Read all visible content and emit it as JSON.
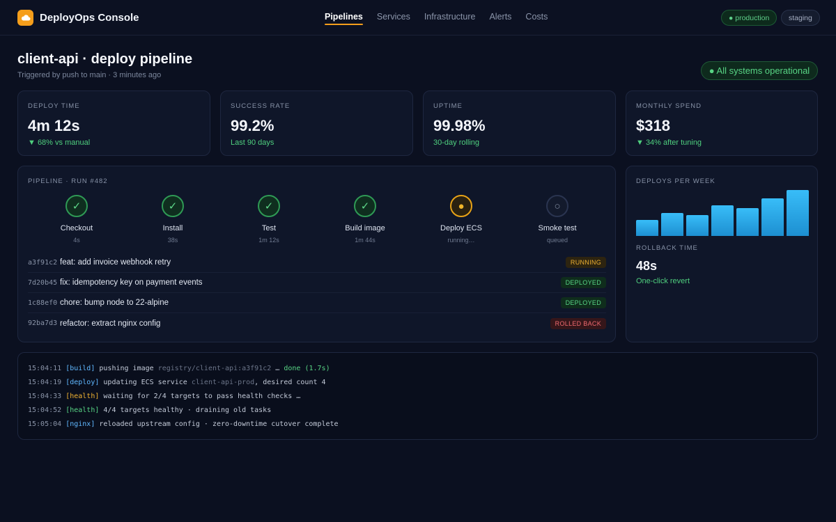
{
  "app": {
    "brand": "DeployOps Console",
    "accent_color": "#f59e1b",
    "logo_icon": "cloud-icon"
  },
  "nav": {
    "items": [
      {
        "label": "Pipelines",
        "active": true
      },
      {
        "label": "Services",
        "active": false
      },
      {
        "label": "Infrastructure",
        "active": false
      },
      {
        "label": "Alerts",
        "active": false
      },
      {
        "label": "Costs",
        "active": false
      }
    ]
  },
  "environments": {
    "production": "● production",
    "staging": "staging"
  },
  "header": {
    "title": "client-api · deploy pipeline",
    "subtitle": "Triggered by push to main · 3 minutes ago",
    "status": "● All systems operational"
  },
  "kpis": [
    {
      "label": "DEPLOY TIME",
      "value": "4m 12s",
      "note": "▼ 68% vs manual"
    },
    {
      "label": "SUCCESS RATE",
      "value": "99.2%",
      "note": "Last 90 days"
    },
    {
      "label": "UPTIME",
      "value": "99.98%",
      "note": "30-day rolling"
    },
    {
      "label": "MONTHLY SPEND",
      "value": "$318",
      "note": "▼ 34% after tuning"
    }
  ],
  "pipeline": {
    "label": "PIPELINE · RUN #482",
    "steps": [
      {
        "name": "Checkout",
        "time": "4s",
        "state": "done",
        "glyph": "✓"
      },
      {
        "name": "Install",
        "time": "38s",
        "state": "done",
        "glyph": "✓"
      },
      {
        "name": "Test",
        "time": "1m 12s",
        "state": "done",
        "glyph": "✓"
      },
      {
        "name": "Build image",
        "time": "1m 44s",
        "state": "done",
        "glyph": "✓"
      },
      {
        "name": "Deploy ECS",
        "time": "running…",
        "state": "running",
        "glyph": "●"
      },
      {
        "name": "Smoke test",
        "time": "queued",
        "state": "queued",
        "glyph": "○"
      }
    ],
    "commits": [
      {
        "sha": "a3f91c2",
        "message": "feat: add invoice webhook retry",
        "status": "RUNNING"
      },
      {
        "sha": "7d20b45",
        "message": "fix: idempotency key on payment events",
        "status": "DEPLOYED"
      },
      {
        "sha": "1c88ef0",
        "message": "chore: bump node to 22-alpine",
        "status": "DEPLOYED"
      },
      {
        "sha": "92ba7d3",
        "message": "refactor: extract nginx config",
        "status": "ROLLED BACK"
      }
    ]
  },
  "deploys_chart": {
    "label": "DEPLOYS PER WEEK",
    "bar_color": "#38bdf8"
  },
  "chart_data": {
    "type": "bar",
    "values": [
      0.35,
      0.5,
      0.45,
      0.67,
      0.6,
      0.82,
      1.0
    ],
    "value_units": "relative to tallest bar"
  },
  "rollback": {
    "label": "ROLLBACK TIME",
    "value": "48s",
    "note": "One-click revert"
  },
  "logs": [
    {
      "ts": "15:04:11",
      "tag": "[build]",
      "text": "pushing image",
      "muted": "registry/client-api:a3f91c2",
      "tail": "…",
      "ok": "done (1.7s)"
    },
    {
      "ts": "15:04:19",
      "tag": "[deploy]",
      "text": "updating ECS service",
      "muted": "client-api-prod",
      "tail": ", desired count 4",
      "ok": ""
    },
    {
      "ts": "15:04:33",
      "tag": "[health]",
      "text": "waiting for 2/4 targets to pass health checks …",
      "muted": "",
      "tail": "",
      "ok": ""
    },
    {
      "ts": "15:04:52",
      "tag": "[health]",
      "text": "4/4 targets healthy · draining old tasks",
      "muted": "",
      "tail": "",
      "ok": ""
    },
    {
      "ts": "15:05:04",
      "tag": "[nginx]",
      "text": "reloaded upstream config · zero-downtime cutover complete",
      "muted": "",
      "tail": "",
      "ok": ""
    }
  ]
}
